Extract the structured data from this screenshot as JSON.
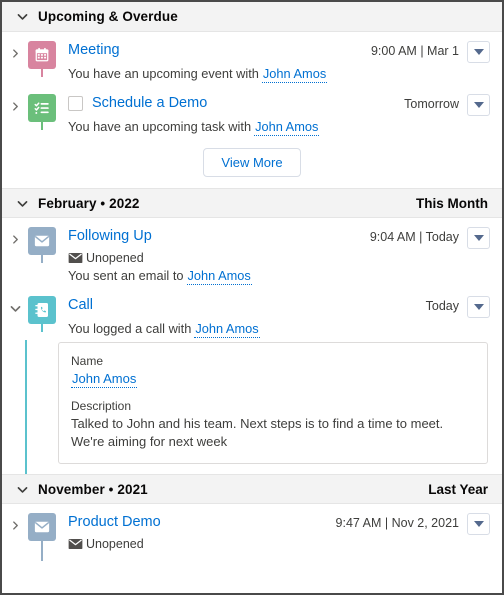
{
  "colors": {
    "link": "#0070d2",
    "header_bg": "#f3f3f3",
    "event_icon": "#d8849f",
    "task_icon": "#6bbf7b",
    "email_icon": "#95aec6",
    "call_icon": "#5bc2cd"
  },
  "sections": [
    {
      "title": "Upcoming & Overdue",
      "right_label": "",
      "expanded": true,
      "chevron": "chevron-down-icon",
      "items": [
        {
          "name": "meeting",
          "icon": "calendar-icon",
          "icon_color": "#d8849f",
          "expanded": false,
          "chevron": "chevron-right-icon",
          "has_checkbox": false,
          "title": "Meeting",
          "meta": "9:00 AM | Mar 1",
          "status": "",
          "description_prefix": "You have an upcoming event with",
          "related_to": "John Amos"
        },
        {
          "name": "schedule-a-demo",
          "icon": "task-checklist-icon",
          "icon_color": "#6bbf7b",
          "expanded": false,
          "chevron": "chevron-right-icon",
          "has_checkbox": true,
          "checkbox_checked": false,
          "title": "Schedule a Demo",
          "meta": "Tomorrow",
          "status": "",
          "description_prefix": "You have an upcoming task with",
          "related_to": "John Amos"
        }
      ],
      "view_more_label": "View More"
    },
    {
      "title": "February • 2022",
      "right_label": "This Month",
      "expanded": true,
      "chevron": "chevron-down-icon",
      "items": [
        {
          "name": "following-up",
          "icon": "email-icon",
          "icon_color": "#95aec6",
          "expanded": false,
          "chevron": "chevron-right-icon",
          "has_checkbox": false,
          "title": "Following Up",
          "meta": "9:04 AM | Today",
          "status": "Unopened",
          "status_icon": "envelope-icon",
          "description_prefix": "You sent an email to",
          "related_to": "John Amos"
        },
        {
          "name": "call",
          "icon": "log-a-call-icon",
          "icon_color": "#5bc2cd",
          "expanded": true,
          "chevron": "chevron-down-icon",
          "has_checkbox": false,
          "title": "Call",
          "meta": "Today",
          "status": "",
          "description_prefix": "You logged a call with",
          "related_to": "John Amos",
          "detail": {
            "name_label": "Name",
            "name_value": "John Amos",
            "description_label": "Description",
            "description_value": "Talked to John and his team. Next steps is to find a time to meet. We're aiming for next week"
          }
        }
      ],
      "view_more_label": ""
    },
    {
      "title": "November • 2021",
      "right_label": "Last Year",
      "expanded": true,
      "chevron": "chevron-down-icon",
      "items": [
        {
          "name": "product-demo",
          "icon": "email-icon",
          "icon_color": "#95aec6",
          "expanded": false,
          "chevron": "chevron-right-icon",
          "has_checkbox": false,
          "title": "Product Demo",
          "meta": "9:47 AM | Nov 2, 2021",
          "status": "Unopened",
          "status_icon": "envelope-icon",
          "description_prefix": "",
          "related_to": ""
        }
      ],
      "view_more_label": ""
    }
  ]
}
